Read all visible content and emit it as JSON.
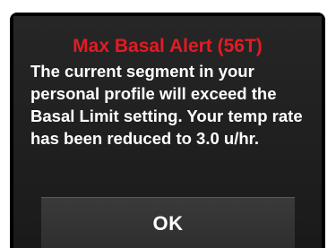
{
  "alert": {
    "title": "Max Basal Alert (56T)",
    "message": "The current segment in your personal profile will exceed the Basal Limit setting. Your temp rate has been reduced to 3.0 u/hr.",
    "title_color": "#e31b23"
  },
  "actions": {
    "ok_label": "OK"
  }
}
